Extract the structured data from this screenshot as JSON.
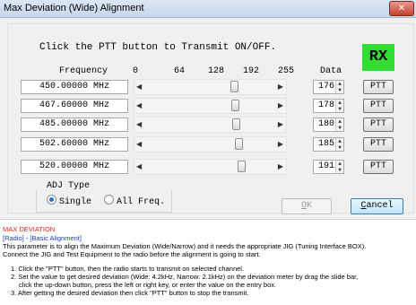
{
  "window": {
    "title": "Max Deviation (Wide) Alignment",
    "close_glyph": "✕"
  },
  "instruction": "Click the PTT button to Transmit ON/OFF.",
  "status": "RX",
  "headers": {
    "frequency": "Frequency",
    "scale": [
      "0",
      "64",
      "128",
      "192",
      "255"
    ],
    "data": "Data"
  },
  "rows": [
    {
      "frequency": "450.00000 MHz",
      "value": 176,
      "ptt": "PTT"
    },
    {
      "frequency": "467.60000 MHz",
      "value": 178,
      "ptt": "PTT"
    },
    {
      "frequency": "485.00000 MHz",
      "value": 180,
      "ptt": "PTT"
    },
    {
      "frequency": "502.60000 MHz",
      "value": 185,
      "ptt": "PTT"
    },
    {
      "frequency": "520.00000 MHz",
      "value": 191,
      "ptt": "PTT"
    }
  ],
  "adj": {
    "label": "ADJ Type",
    "options": [
      "Single",
      "All Freq."
    ],
    "selected": "Single"
  },
  "buttons": {
    "ok_underlined": "O",
    "ok_rest": "K",
    "cancel_underlined": "C",
    "cancel_rest": "ancel"
  },
  "help": {
    "heading": "MAX DEVIATION",
    "path": "[Radio] - [Basic Alignment]",
    "para1": "This parameter is to align the Maximum Deviation (Wide/Narrow) and it needs the appropriate JIG (Tuning Interface BOX).",
    "para2": "Connect the JIG and Test Equipment to the radio before the alignment is going to start.",
    "steps": [
      "1. Click the \"PTT\" button, then the radio starts to transmit on selected channel.",
      "2. Set the value to get desired deviation (Wide: 4.2kHz, Narrow: 2.1kHz) on the deviation meter by drag the slide bar,",
      "click the up-down button, press the left or right key, or enter the value on the entry box.",
      "3. After getting the desired deviation then click \"PTT\" button to stop the transmit."
    ]
  }
}
